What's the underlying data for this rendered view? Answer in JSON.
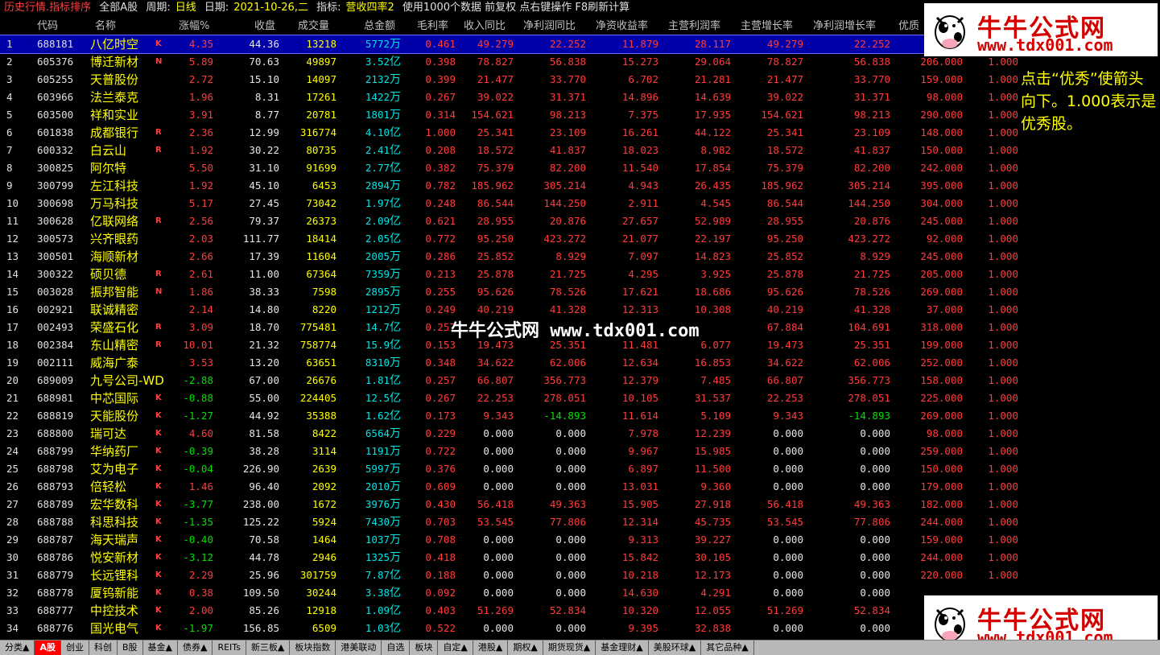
{
  "topbar": {
    "title": "历史行情.指标排序",
    "scope": "全部A股",
    "period_label": "周期:",
    "period_value": "日线",
    "date_label": "日期:",
    "date_value": "2021-10-26,二",
    "indicator_label": "指标:",
    "indicator_value": "营收四率2",
    "hint": "使用1000个数据 前复权 点右键操作 F8刷新计算"
  },
  "columns": [
    "代码",
    "名称",
    "涨幅%",
    "收盘",
    "成交量",
    "总金额",
    "毛利率",
    "收入同比",
    "净利润同比",
    "净资收益率",
    "主营利润率",
    "主营增长率",
    "净利润增长率",
    "优质"
  ],
  "rows": [
    {
      "idx": "1",
      "code": "688181",
      "name": "八亿时空",
      "flag": "K",
      "chg": "4.35",
      "close": "44.36",
      "vol": "13218",
      "amt": "5772",
      "unit": "万",
      "gm": "0.461",
      "rev": "49.279",
      "np": "22.252",
      "roe": "11.879",
      "opm": "28.117",
      "og": "49.279",
      "npg": "22.252",
      "q": "",
      "qv": "",
      "dir": "up"
    },
    {
      "idx": "2",
      "code": "605376",
      "name": "博迁新材",
      "flag": "N",
      "chg": "5.89",
      "close": "70.63",
      "vol": "49897",
      "amt": "3.52",
      "unit": "亿",
      "gm": "0.398",
      "rev": "78.827",
      "np": "56.838",
      "roe": "15.273",
      "opm": "29.064",
      "og": "78.827",
      "npg": "56.838",
      "q": "206.000",
      "qv": "1.000",
      "dir": "up"
    },
    {
      "idx": "3",
      "code": "605255",
      "name": "天普股份",
      "flag": "",
      "chg": "2.72",
      "close": "15.10",
      "vol": "14097",
      "amt": "2132",
      "unit": "万",
      "gm": "0.399",
      "rev": "21.477",
      "np": "33.770",
      "roe": "6.702",
      "opm": "21.281",
      "og": "21.477",
      "npg": "33.770",
      "q": "159.000",
      "qv": "1.000",
      "dir": "up"
    },
    {
      "idx": "4",
      "code": "603966",
      "name": "法兰泰克",
      "flag": "",
      "chg": "1.96",
      "close": "8.31",
      "vol": "17261",
      "amt": "1422",
      "unit": "万",
      "gm": "0.267",
      "rev": "39.022",
      "np": "31.371",
      "roe": "14.896",
      "opm": "14.639",
      "og": "39.022",
      "npg": "31.371",
      "q": "98.000",
      "qv": "1.000",
      "dir": "up"
    },
    {
      "idx": "5",
      "code": "603500",
      "name": "祥和实业",
      "flag": "",
      "chg": "3.91",
      "close": "8.77",
      "vol": "20781",
      "amt": "1801",
      "unit": "万",
      "gm": "0.314",
      "rev": "154.621",
      "np": "98.213",
      "roe": "7.375",
      "opm": "17.935",
      "og": "154.621",
      "npg": "98.213",
      "q": "290.000",
      "qv": "1.000",
      "dir": "up"
    },
    {
      "idx": "6",
      "code": "601838",
      "name": "成都银行",
      "flag": "R",
      "chg": "2.36",
      "close": "12.99",
      "vol": "316774",
      "amt": "4.10",
      "unit": "亿",
      "gm": "1.000",
      "rev": "25.341",
      "np": "23.109",
      "roe": "16.261",
      "opm": "44.122",
      "og": "25.341",
      "npg": "23.109",
      "q": "148.000",
      "qv": "1.000",
      "dir": "up"
    },
    {
      "idx": "7",
      "code": "600332",
      "name": "白云山",
      "flag": "R",
      "chg": "1.92",
      "close": "30.22",
      "vol": "80735",
      "amt": "2.41",
      "unit": "亿",
      "gm": "0.208",
      "rev": "18.572",
      "np": "41.837",
      "roe": "18.023",
      "opm": "8.982",
      "og": "18.572",
      "npg": "41.837",
      "q": "150.000",
      "qv": "1.000",
      "dir": "up"
    },
    {
      "idx": "8",
      "code": "300825",
      "name": "阿尔特",
      "flag": "",
      "chg": "5.50",
      "close": "31.10",
      "vol": "91699",
      "amt": "2.77",
      "unit": "亿",
      "gm": "0.382",
      "rev": "75.379",
      "np": "82.200",
      "roe": "11.540",
      "opm": "17.854",
      "og": "75.379",
      "npg": "82.200",
      "q": "242.000",
      "qv": "1.000",
      "dir": "up"
    },
    {
      "idx": "9",
      "code": "300799",
      "name": "左江科技",
      "flag": "",
      "chg": "1.92",
      "close": "45.10",
      "vol": "6453",
      "amt": "2894",
      "unit": "万",
      "gm": "0.782",
      "rev": "185.962",
      "np": "305.214",
      "roe": "4.943",
      "opm": "26.435",
      "og": "185.962",
      "npg": "305.214",
      "q": "395.000",
      "qv": "1.000",
      "dir": "up"
    },
    {
      "idx": "10",
      "code": "300698",
      "name": "万马科技",
      "flag": "",
      "chg": "5.17",
      "close": "27.45",
      "vol": "73042",
      "amt": "1.97",
      "unit": "亿",
      "gm": "0.248",
      "rev": "86.544",
      "np": "144.250",
      "roe": "2.911",
      "opm": "4.545",
      "og": "86.544",
      "npg": "144.250",
      "q": "304.000",
      "qv": "1.000",
      "dir": "up"
    },
    {
      "idx": "11",
      "code": "300628",
      "name": "亿联网络",
      "flag": "R",
      "chg": "2.56",
      "close": "79.37",
      "vol": "26373",
      "amt": "2.09",
      "unit": "亿",
      "gm": "0.621",
      "rev": "28.955",
      "np": "20.876",
      "roe": "27.657",
      "opm": "52.989",
      "og": "28.955",
      "npg": "20.876",
      "q": "245.000",
      "qv": "1.000",
      "dir": "up"
    },
    {
      "idx": "12",
      "code": "300573",
      "name": "兴齐眼药",
      "flag": "",
      "chg": "2.03",
      "close": "111.77",
      "vol": "18414",
      "amt": "2.05",
      "unit": "亿",
      "gm": "0.772",
      "rev": "95.250",
      "np": "423.272",
      "roe": "21.077",
      "opm": "22.197",
      "og": "95.250",
      "npg": "423.272",
      "q": "92.000",
      "qv": "1.000",
      "dir": "up"
    },
    {
      "idx": "13",
      "code": "300501",
      "name": "海顺新材",
      "flag": "",
      "chg": "2.66",
      "close": "17.39",
      "vol": "11604",
      "amt": "2005",
      "unit": "万",
      "gm": "0.286",
      "rev": "25.852",
      "np": "8.929",
      "roe": "7.097",
      "opm": "14.823",
      "og": "25.852",
      "npg": "8.929",
      "q": "245.000",
      "qv": "1.000",
      "dir": "up"
    },
    {
      "idx": "14",
      "code": "300322",
      "name": "硕贝德",
      "flag": "R",
      "chg": "2.61",
      "close": "11.00",
      "vol": "67364",
      "amt": "7359",
      "unit": "万",
      "gm": "0.213",
      "rev": "25.878",
      "np": "21.725",
      "roe": "4.295",
      "opm": "3.925",
      "og": "25.878",
      "npg": "21.725",
      "q": "205.000",
      "qv": "1.000",
      "dir": "up"
    },
    {
      "idx": "15",
      "code": "003028",
      "name": "振邦智能",
      "flag": "N",
      "chg": "1.86",
      "close": "38.33",
      "vol": "7598",
      "amt": "2895",
      "unit": "万",
      "gm": "0.255",
      "rev": "95.626",
      "np": "78.526",
      "roe": "17.621",
      "opm": "18.686",
      "og": "95.626",
      "npg": "78.526",
      "q": "269.000",
      "qv": "1.000",
      "dir": "up"
    },
    {
      "idx": "16",
      "code": "002921",
      "name": "联诚精密",
      "flag": "",
      "chg": "2.14",
      "close": "14.80",
      "vol": "8220",
      "amt": "1212",
      "unit": "万",
      "gm": "0.249",
      "rev": "40.219",
      "np": "41.328",
      "roe": "12.313",
      "opm": "10.308",
      "og": "40.219",
      "npg": "41.328",
      "q": "37.000",
      "qv": "1.000",
      "dir": "up"
    },
    {
      "idx": "17",
      "code": "002493",
      "name": "荣盛石化",
      "flag": "R",
      "chg": "3.09",
      "close": "18.70",
      "vol": "775481",
      "amt": "14.7",
      "unit": "亿",
      "gm": "0.257",
      "rev": "",
      "np": "",
      "roe": "",
      "opm": "",
      "og": "67.884",
      "npg": "104.691",
      "q": "318.000",
      "qv": "1.000",
      "dir": "up"
    },
    {
      "idx": "18",
      "code": "002384",
      "name": "东山精密",
      "flag": "R",
      "chg": "10.01",
      "close": "21.32",
      "vol": "758774",
      "amt": "15.9",
      "unit": "亿",
      "gm": "0.153",
      "rev": "19.473",
      "np": "25.351",
      "roe": "11.481",
      "opm": "6.077",
      "og": "19.473",
      "npg": "25.351",
      "q": "199.000",
      "qv": "1.000",
      "dir": "up"
    },
    {
      "idx": "19",
      "code": "002111",
      "name": "威海广泰",
      "flag": "",
      "chg": "3.53",
      "close": "13.20",
      "vol": "63651",
      "amt": "8310",
      "unit": "万",
      "gm": "0.348",
      "rev": "34.622",
      "np": "62.006",
      "roe": "12.634",
      "opm": "16.853",
      "og": "34.622",
      "npg": "62.006",
      "q": "252.000",
      "qv": "1.000",
      "dir": "up"
    },
    {
      "idx": "20",
      "code": "689009",
      "name": "九号公司-WD",
      "flag": "",
      "chg": "-2.88",
      "close": "67.00",
      "vol": "26676",
      "amt": "1.81",
      "unit": "亿",
      "gm": "0.257",
      "rev": "66.807",
      "np": "356.773",
      "roe": "12.379",
      "opm": "7.485",
      "og": "66.807",
      "npg": "356.773",
      "q": "158.000",
      "qv": "1.000",
      "dir": "down"
    },
    {
      "idx": "21",
      "code": "688981",
      "name": "中芯国际",
      "flag": "K",
      "chg": "-0.88",
      "close": "55.00",
      "vol": "224405",
      "amt": "12.5",
      "unit": "亿",
      "gm": "0.267",
      "rev": "22.253",
      "np": "278.051",
      "roe": "10.105",
      "opm": "31.537",
      "og": "22.253",
      "npg": "278.051",
      "q": "225.000",
      "qv": "1.000",
      "dir": "down"
    },
    {
      "idx": "22",
      "code": "688819",
      "name": "天能股份",
      "flag": "K",
      "chg": "-1.27",
      "close": "44.92",
      "vol": "35388",
      "amt": "1.62",
      "unit": "亿",
      "gm": "0.173",
      "rev": "9.343",
      "np": "-14.893",
      "roe": "11.614",
      "opm": "5.109",
      "og": "9.343",
      "npg": "-14.893",
      "q": "269.000",
      "qv": "1.000",
      "dir": "down"
    },
    {
      "idx": "23",
      "code": "688800",
      "name": "瑞可达",
      "flag": "K",
      "chg": "4.60",
      "close": "81.58",
      "vol": "8422",
      "amt": "6564",
      "unit": "万",
      "gm": "0.229",
      "rev": "0.000",
      "np": "0.000",
      "roe": "7.978",
      "opm": "12.239",
      "og": "0.000",
      "npg": "0.000",
      "q": "98.000",
      "qv": "1.000",
      "dir": "up"
    },
    {
      "idx": "24",
      "code": "688799",
      "name": "华纳药厂",
      "flag": "K",
      "chg": "-0.39",
      "close": "38.28",
      "vol": "3114",
      "amt": "1191",
      "unit": "万",
      "gm": "0.722",
      "rev": "0.000",
      "np": "0.000",
      "roe": "9.967",
      "opm": "15.985",
      "og": "0.000",
      "npg": "0.000",
      "q": "259.000",
      "qv": "1.000",
      "dir": "down"
    },
    {
      "idx": "25",
      "code": "688798",
      "name": "艾为电子",
      "flag": "K",
      "chg": "-0.04",
      "close": "226.90",
      "vol": "2639",
      "amt": "5997",
      "unit": "万",
      "gm": "0.376",
      "rev": "0.000",
      "np": "0.000",
      "roe": "6.897",
      "opm": "11.500",
      "og": "0.000",
      "npg": "0.000",
      "q": "150.000",
      "qv": "1.000",
      "dir": "down"
    },
    {
      "idx": "26",
      "code": "688793",
      "name": "倍轻松",
      "flag": "K",
      "chg": "1.46",
      "close": "96.40",
      "vol": "2092",
      "amt": "2010",
      "unit": "万",
      "gm": "0.609",
      "rev": "0.000",
      "np": "0.000",
      "roe": "13.031",
      "opm": "9.360",
      "og": "0.000",
      "npg": "0.000",
      "q": "179.000",
      "qv": "1.000",
      "dir": "up"
    },
    {
      "idx": "27",
      "code": "688789",
      "name": "宏华数科",
      "flag": "K",
      "chg": "-3.77",
      "close": "238.00",
      "vol": "1672",
      "amt": "3976",
      "unit": "万",
      "gm": "0.430",
      "rev": "56.418",
      "np": "49.363",
      "roe": "15.905",
      "opm": "27.918",
      "og": "56.418",
      "npg": "49.363",
      "q": "182.000",
      "qv": "1.000",
      "dir": "down"
    },
    {
      "idx": "28",
      "code": "688788",
      "name": "科思科技",
      "flag": "K",
      "chg": "-1.35",
      "close": "125.22",
      "vol": "5924",
      "amt": "7430",
      "unit": "万",
      "gm": "0.703",
      "rev": "53.545",
      "np": "77.806",
      "roe": "12.314",
      "opm": "45.735",
      "og": "53.545",
      "npg": "77.806",
      "q": "244.000",
      "qv": "1.000",
      "dir": "down"
    },
    {
      "idx": "29",
      "code": "688787",
      "name": "海天瑞声",
      "flag": "K",
      "chg": "-0.40",
      "close": "70.58",
      "vol": "1464",
      "amt": "1037",
      "unit": "万",
      "gm": "0.708",
      "rev": "0.000",
      "np": "0.000",
      "roe": "9.313",
      "opm": "39.227",
      "og": "0.000",
      "npg": "0.000",
      "q": "159.000",
      "qv": "1.000",
      "dir": "down"
    },
    {
      "idx": "30",
      "code": "688786",
      "name": "悦安新材",
      "flag": "K",
      "chg": "-3.12",
      "close": "44.78",
      "vol": "2946",
      "amt": "1325",
      "unit": "万",
      "gm": "0.418",
      "rev": "0.000",
      "np": "0.000",
      "roe": "15.842",
      "opm": "30.105",
      "og": "0.000",
      "npg": "0.000",
      "q": "244.000",
      "qv": "1.000",
      "dir": "down"
    },
    {
      "idx": "31",
      "code": "688779",
      "name": "长远锂科",
      "flag": "K",
      "chg": "2.29",
      "close": "25.96",
      "vol": "301759",
      "amt": "7.87",
      "unit": "亿",
      "gm": "0.188",
      "rev": "0.000",
      "np": "0.000",
      "roe": "10.218",
      "opm": "12.173",
      "og": "0.000",
      "npg": "0.000",
      "q": "220.000",
      "qv": "1.000",
      "dir": "up"
    },
    {
      "idx": "32",
      "code": "688778",
      "name": "厦钨新能",
      "flag": "K",
      "chg": "0.38",
      "close": "109.50",
      "vol": "30244",
      "amt": "3.38",
      "unit": "亿",
      "gm": "0.092",
      "rev": "0.000",
      "np": "0.000",
      "roe": "14.630",
      "opm": "4.291",
      "og": "0.000",
      "npg": "0.000",
      "q": "",
      "qv": "",
      "dir": "up"
    },
    {
      "idx": "33",
      "code": "688777",
      "name": "中控技术",
      "flag": "K",
      "chg": "2.00",
      "close": "85.26",
      "vol": "12918",
      "amt": "1.09",
      "unit": "亿",
      "gm": "0.403",
      "rev": "51.269",
      "np": "52.834",
      "roe": "10.320",
      "opm": "12.055",
      "og": "51.269",
      "npg": "52.834",
      "q": "",
      "qv": "",
      "dir": "up"
    },
    {
      "idx": "34",
      "code": "688776",
      "name": "国光电气",
      "flag": "K",
      "chg": "-1.97",
      "close": "156.85",
      "vol": "6509",
      "amt": "1.03",
      "unit": "亿",
      "gm": "0.522",
      "rev": "0.000",
      "np": "0.000",
      "roe": "9.395",
      "opm": "32.838",
      "og": "0.000",
      "npg": "0.000",
      "q": "",
      "qv": "",
      "dir": "down"
    }
  ],
  "watermark": {
    "center": "牛牛公式网 www.tdx001.com",
    "logo_cn": "牛牛公式网",
    "logo_url": "www.tdx001.com"
  },
  "note": "点击“优秀”使箭头向下。1.000表示是优秀股。",
  "tabs": [
    "分类▲",
    "A股",
    "创业",
    "科创",
    "B股",
    "基金▲",
    "债券▲",
    "REITs",
    "新三板▲",
    "板块指数",
    "港美联动",
    "自选",
    "板块",
    "自定▲",
    "港股▲",
    "期权▲",
    "期货现货▲",
    "基金理财▲",
    "美股环球▲",
    "其它品种▲"
  ],
  "active_tab": "A股",
  "colors": {
    "up": "#ff3c3c",
    "down": "#00e000",
    "name": "#ffff00",
    "amount": "#00e6e6",
    "selected_row": "#0000a8",
    "background": "#000000"
  }
}
